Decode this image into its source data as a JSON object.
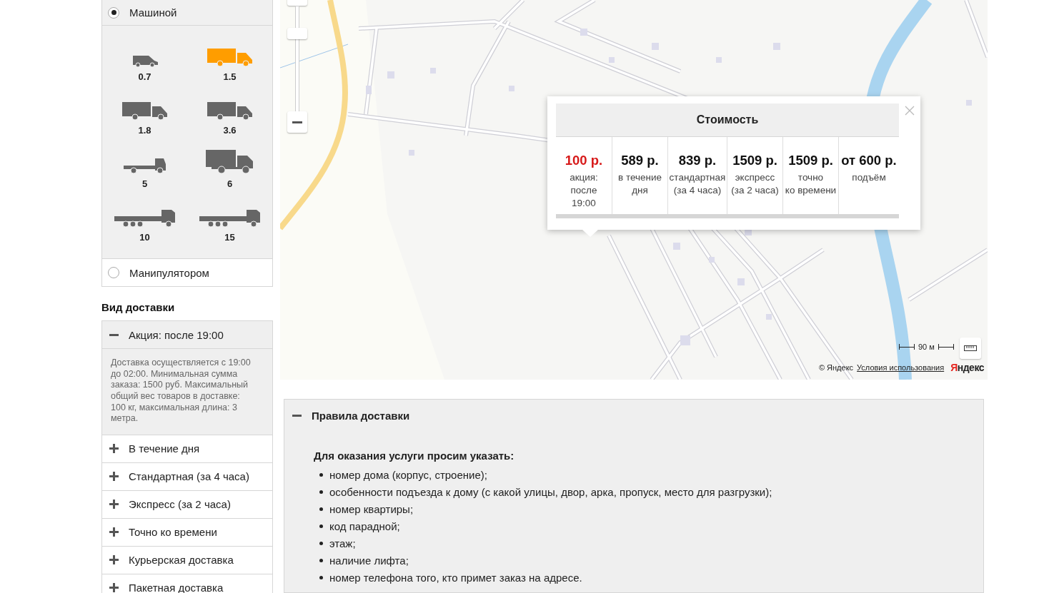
{
  "transport": {
    "options": [
      {
        "label": "Машиной",
        "selected": true
      },
      {
        "label": "Манипулятором",
        "selected": false
      }
    ],
    "vehicles": [
      {
        "label": "0.7",
        "kind": "van",
        "selected": false
      },
      {
        "label": "1.5",
        "kind": "box",
        "selected": true
      },
      {
        "label": "1.8",
        "kind": "box",
        "selected": false
      },
      {
        "label": "3.6",
        "kind": "box",
        "selected": false
      },
      {
        "label": "5",
        "kind": "flatbed",
        "selected": false
      },
      {
        "label": "6",
        "kind": "bigbox",
        "selected": false
      },
      {
        "label": "10",
        "kind": "longflat",
        "selected": false
      },
      {
        "label": "15",
        "kind": "longflat",
        "selected": false
      }
    ]
  },
  "delivery_type": {
    "title": "Вид доставки",
    "items": [
      {
        "label": "Акция: после 19:00",
        "expanded": true,
        "description": "Доставка осуществляется с 19:00 до 02:00. Минимальная сумма заказа: 1500 руб. Максимальный общий вес товаров в доставке: 100 кг, максимальная длина: 3 метра."
      },
      {
        "label": "В течение дня",
        "expanded": false
      },
      {
        "label": "Стандартная (за 4 часа)",
        "expanded": false
      },
      {
        "label": "Экспресс (за 2 часа)",
        "expanded": false
      },
      {
        "label": "Точно ко времени",
        "expanded": false
      },
      {
        "label": "Курьерская доставка",
        "expanded": false
      },
      {
        "label": "Пакетная доставка",
        "expanded": false
      }
    ]
  },
  "map": {
    "scale": "90 м",
    "copyright": "© Яндекс",
    "terms_link": "Условия использования",
    "logo": "Яндекс",
    "price_balloon": {
      "title": "Стоимость",
      "columns": [
        {
          "price": "100 р.",
          "caption": "акция:\nпосле\n19:00",
          "highlighted": true
        },
        {
          "price": "589 р.",
          "caption": "в течение\nдня",
          "highlighted": false
        },
        {
          "price": "839 р.",
          "caption": "стандартная\n(за 4 часа)",
          "highlighted": false
        },
        {
          "price": "1509 р.",
          "caption": "экспресс\n(за 2 часа)",
          "highlighted": false
        },
        {
          "price": "1509 р.",
          "caption": "точно\nко времени",
          "highlighted": false
        },
        {
          "price": "от 600 р.",
          "caption": "подъём",
          "highlighted": false
        }
      ]
    }
  },
  "rules": {
    "title": "Правила доставки",
    "expanded": true,
    "intro": "Для оказания услуги просим указать:",
    "items": [
      "номер дома (корпус, строение);",
      "особенности подъезда к дому (с какой улицы, двор, арка, пропуск, место для разгрузки);",
      "номер квартиры;",
      "код парадной;",
      "этаж;",
      "наличие лифта;",
      "номер телефона того, кто примет заказ на адресе."
    ]
  }
}
